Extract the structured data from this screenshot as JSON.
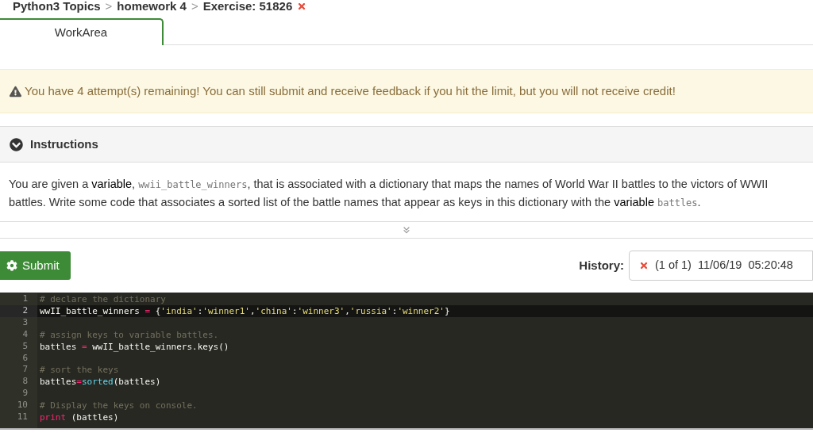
{
  "breadcrumb": [
    {
      "text": "Python3 Topics"
    },
    {
      "text": "homework 4"
    },
    {
      "text": "Exercise: 51826"
    }
  ],
  "breadcrumb_separator": ">",
  "exercise_failed": true,
  "tabs": [
    {
      "label": "WorkArea",
      "selected": true
    }
  ],
  "warning": "You have 4 attempt(s) remaining! You can still submit and receive feedback if you hit the limit, but you will not receive credit!",
  "instructions": {
    "title": "Instructions",
    "expanded": true,
    "parts": [
      {
        "kind": "text",
        "text": "You are given a "
      },
      {
        "kind": "term",
        "text": "variable"
      },
      {
        "kind": "text",
        "text": ", "
      },
      {
        "kind": "code",
        "text": "wwii_battle_winners"
      },
      {
        "kind": "text",
        "text": ", that is associated with a dictionary that maps the names of World War II battles to the victors of WWII battles. Write some code that associates a sorted list of the battle names that appear as keys in this dictionary with the "
      },
      {
        "kind": "term",
        "text": "variable "
      },
      {
        "kind": "code",
        "text": "battles"
      },
      {
        "kind": "text",
        "text": "."
      }
    ]
  },
  "submit_label": "Submit",
  "history": {
    "label": "History:",
    "failed": true,
    "entry": "(1 of 1)  11/06/19  05:20:48"
  },
  "editor_lines": [
    {
      "number": "1",
      "selected": false,
      "tokens": [
        {
          "kind": "comment",
          "text": "# declare the dictionary"
        }
      ]
    },
    {
      "number": "2",
      "selected": true,
      "tokens": [
        {
          "kind": "plain",
          "text": "wwII_battle_winners "
        },
        {
          "kind": "op",
          "text": "="
        },
        {
          "kind": "plain",
          "text": " {"
        },
        {
          "kind": "string",
          "text": "'india'"
        },
        {
          "kind": "plain",
          "text": ":"
        },
        {
          "kind": "string",
          "text": "'winner1'"
        },
        {
          "kind": "plain",
          "text": ","
        },
        {
          "kind": "string",
          "text": "'china'"
        },
        {
          "kind": "plain",
          "text": ":"
        },
        {
          "kind": "string",
          "text": "'winner3'"
        },
        {
          "kind": "plain",
          "text": ","
        },
        {
          "kind": "string",
          "text": "'russia'"
        },
        {
          "kind": "plain",
          "text": ":"
        },
        {
          "kind": "string",
          "text": "'winner2'"
        },
        {
          "kind": "plain",
          "text": "}"
        }
      ]
    },
    {
      "number": "3",
      "selected": false
    },
    {
      "number": "4",
      "selected": false,
      "tokens": [
        {
          "kind": "comment",
          "text": "# assign keys to variable battles."
        }
      ]
    },
    {
      "number": "5",
      "selected": false,
      "tokens": [
        {
          "kind": "plain",
          "text": "battles "
        },
        {
          "kind": "op",
          "text": "="
        },
        {
          "kind": "plain",
          "text": " wwII_battle_winners.keys()"
        }
      ]
    },
    {
      "number": "6",
      "selected": false
    },
    {
      "number": "7",
      "selected": false,
      "tokens": [
        {
          "kind": "comment",
          "text": "# sort the keys"
        }
      ]
    },
    {
      "number": "8",
      "selected": false,
      "tokens": [
        {
          "kind": "plain",
          "text": "battles"
        },
        {
          "kind": "op",
          "text": "="
        },
        {
          "kind": "builtin",
          "text": "sorted"
        },
        {
          "kind": "plain",
          "text": "(battles)"
        }
      ]
    },
    {
      "number": "9",
      "selected": false
    },
    {
      "number": "10",
      "selected": false,
      "tokens": [
        {
          "kind": "comment",
          "text": "# Display the keys on console."
        }
      ]
    },
    {
      "number": "11",
      "selected": false,
      "tokens": [
        {
          "kind": "keyword",
          "text": "print"
        },
        {
          "kind": "plain",
          "text": " (battles)"
        }
      ]
    }
  ]
}
